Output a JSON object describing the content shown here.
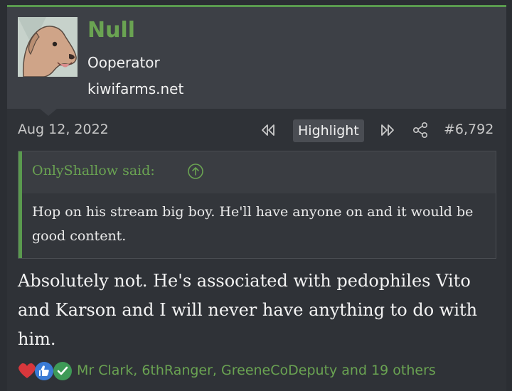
{
  "user": {
    "name": "Null",
    "title": "Ooperator",
    "site": "kiwifarms.net"
  },
  "post": {
    "date": "Aug 12, 2022",
    "highlight_label": "Highlight",
    "number": "#6,792",
    "body": "Absolutely not. He's associated with pedophiles Vito and Karson and I will never have anything to do with him."
  },
  "quote": {
    "author_line": "OnlyShallow said:",
    "text": "Hop on his stream big boy. He'll have anyone on and it would be good content."
  },
  "reactions": {
    "icons": [
      "heart-icon",
      "like-icon",
      "check-icon"
    ],
    "users_text": "Mr Clark, 6thRanger, GreeneCoDeputy and 19 others"
  },
  "colors": {
    "accent": "#6aa352",
    "background": "#2f3237",
    "header": "#3d4046"
  }
}
